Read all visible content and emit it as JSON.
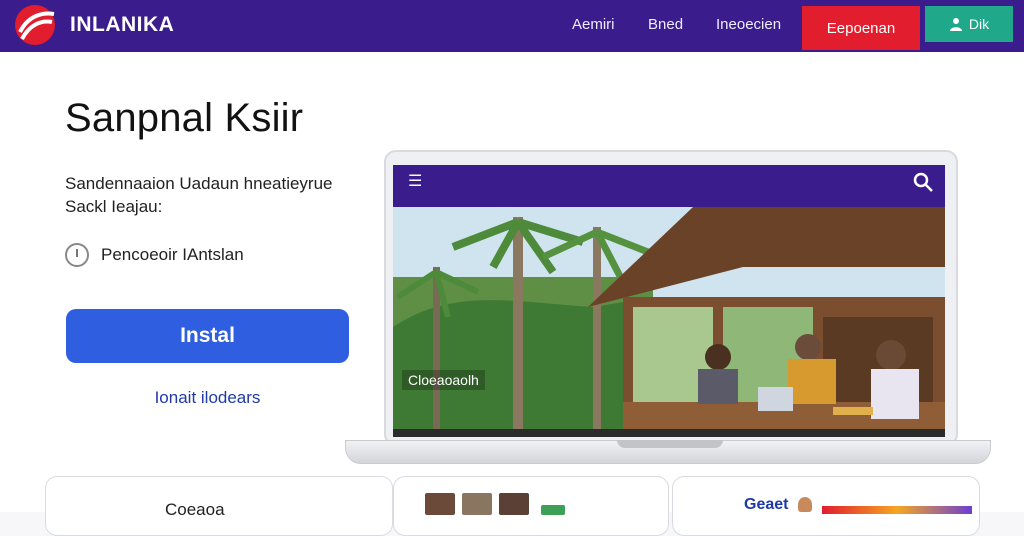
{
  "header": {
    "brand": "INLANIKA",
    "nav": [
      "Aemiri",
      "Bned",
      "Ineoecien"
    ],
    "primary_cta": "Eepoenan",
    "secondary_cta": "Dik",
    "secondary_cta_icon": "user-icon"
  },
  "hero": {
    "title": "Sanpnal Ksiir",
    "description": "Sandennaaion Uadaun hneatieyrue Sackl Ieajau:",
    "feature": "Pencoeoir IAntslan",
    "install_label": "Instal",
    "secondary_link": "Ionait ilodears"
  },
  "preview": {
    "menu_icon": "menu-icon",
    "search_icon": "search-icon",
    "caption": "Cloeaoaolh"
  },
  "cards": {
    "card1_text": "Coeaoa",
    "card3_text": "Geaet"
  },
  "colors": {
    "header": "#3a1c8c",
    "primary": "#2f5ee0",
    "danger": "#e11d2e",
    "success": "#1fa98a"
  }
}
